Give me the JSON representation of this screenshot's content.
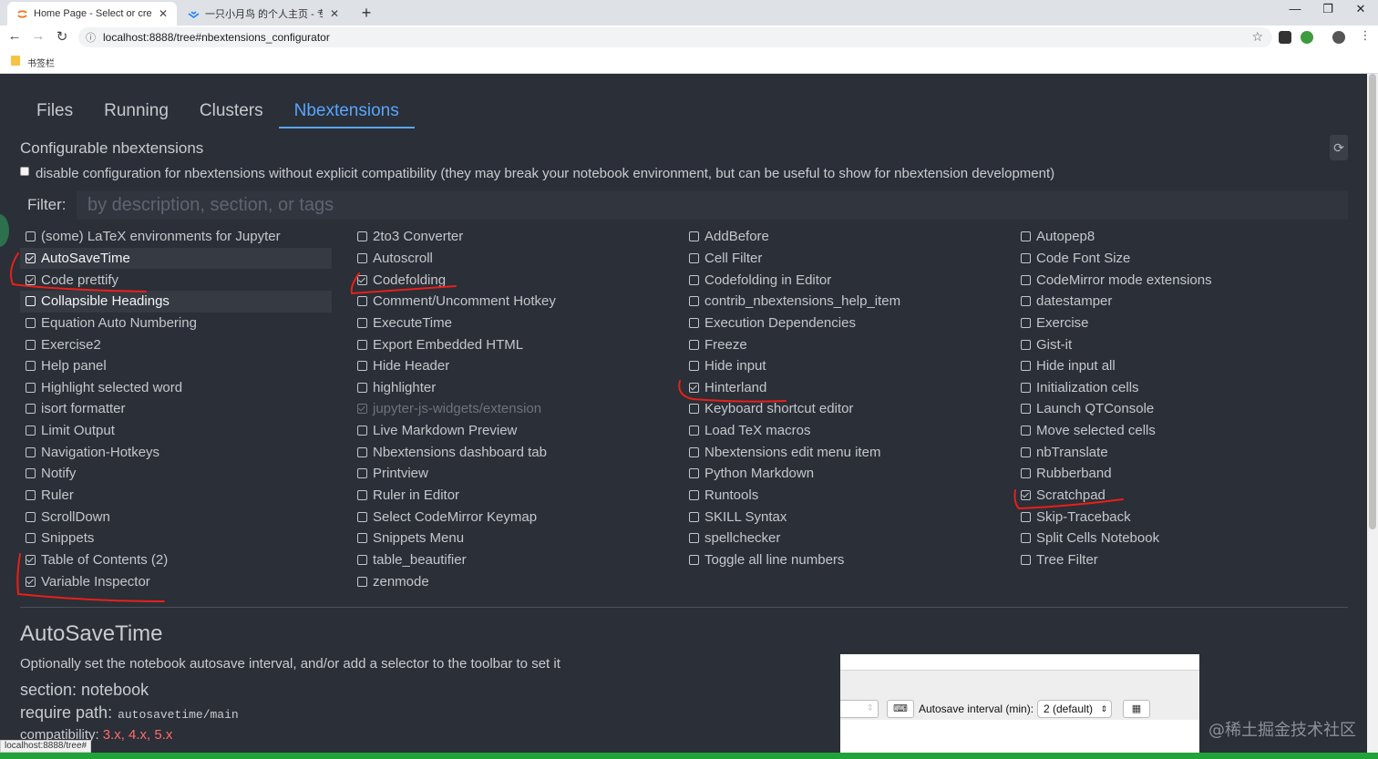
{
  "browser": {
    "tabs": [
      {
        "title": "Home Page - Select or create",
        "active": true
      },
      {
        "title": "一只小月鸟 的个人主页 - 专栏 -",
        "active": false
      }
    ],
    "url": "localhost:8888/tree#nbextensions_configurator",
    "bookmarks_label": "书签栏"
  },
  "nav": {
    "tabs": [
      "Files",
      "Running",
      "Clusters",
      "Nbextensions"
    ],
    "active": "Nbextensions"
  },
  "configurable_title": "Configurable nbextensions",
  "compat_checkbox_label": "disable configuration for nbextensions without explicit compatibility (they may break your notebook environment, but can be useful to show for nbextension development)",
  "filter": {
    "label": "Filter:",
    "placeholder": "by description, section, or tags"
  },
  "extensions": [
    {
      "label": "(some) LaTeX environments for Jupyter",
      "checked": false
    },
    {
      "label": "2to3 Converter",
      "checked": false
    },
    {
      "label": "AddBefore",
      "checked": false
    },
    {
      "label": "Autopep8",
      "checked": false
    },
    {
      "label": "AutoSaveTime",
      "checked": true,
      "selected": true
    },
    {
      "label": "Autoscroll",
      "checked": false
    },
    {
      "label": "Cell Filter",
      "checked": false
    },
    {
      "label": "Code Font Size",
      "checked": false
    },
    {
      "label": "Code prettify",
      "checked": true
    },
    {
      "label": "Codefolding",
      "checked": true
    },
    {
      "label": "Codefolding in Editor",
      "checked": false
    },
    {
      "label": "CodeMirror mode extensions",
      "checked": false
    },
    {
      "label": "Collapsible Headings",
      "checked": false,
      "selected": true
    },
    {
      "label": "Comment/Uncomment Hotkey",
      "checked": false
    },
    {
      "label": "contrib_nbextensions_help_item",
      "checked": false
    },
    {
      "label": "datestamper",
      "checked": false
    },
    {
      "label": "Equation Auto Numbering",
      "checked": false
    },
    {
      "label": "ExecuteTime",
      "checked": false
    },
    {
      "label": "Execution Dependencies",
      "checked": false
    },
    {
      "label": "Exercise",
      "checked": false
    },
    {
      "label": "Exercise2",
      "checked": false
    },
    {
      "label": "Export Embedded HTML",
      "checked": false
    },
    {
      "label": "Freeze",
      "checked": false
    },
    {
      "label": "Gist-it",
      "checked": false
    },
    {
      "label": "Help panel",
      "checked": false
    },
    {
      "label": "Hide Header",
      "checked": false
    },
    {
      "label": "Hide input",
      "checked": false
    },
    {
      "label": "Hide input all",
      "checked": false
    },
    {
      "label": "Highlight selected word",
      "checked": false
    },
    {
      "label": "highlighter",
      "checked": false
    },
    {
      "label": "Hinterland",
      "checked": true
    },
    {
      "label": "Initialization cells",
      "checked": false
    },
    {
      "label": "isort formatter",
      "checked": false
    },
    {
      "label": "jupyter-js-widgets/extension",
      "checked": true,
      "disabled": true
    },
    {
      "label": "Keyboard shortcut editor",
      "checked": false
    },
    {
      "label": "Launch QTConsole",
      "checked": false
    },
    {
      "label": "Limit Output",
      "checked": false
    },
    {
      "label": "Live Markdown Preview",
      "checked": false
    },
    {
      "label": "Load TeX macros",
      "checked": false
    },
    {
      "label": "Move selected cells",
      "checked": false
    },
    {
      "label": "Navigation-Hotkeys",
      "checked": false
    },
    {
      "label": "Nbextensions dashboard tab",
      "checked": false
    },
    {
      "label": "Nbextensions edit menu item",
      "checked": false
    },
    {
      "label": "nbTranslate",
      "checked": false
    },
    {
      "label": "Notify",
      "checked": false
    },
    {
      "label": "Printview",
      "checked": false
    },
    {
      "label": "Python Markdown",
      "checked": false
    },
    {
      "label": "Rubberband",
      "checked": false
    },
    {
      "label": "Ruler",
      "checked": false
    },
    {
      "label": "Ruler in Editor",
      "checked": false
    },
    {
      "label": "Runtools",
      "checked": false
    },
    {
      "label": "Scratchpad",
      "checked": true
    },
    {
      "label": "ScrollDown",
      "checked": false
    },
    {
      "label": "Select CodeMirror Keymap",
      "checked": false
    },
    {
      "label": "SKILL Syntax",
      "checked": false
    },
    {
      "label": "Skip-Traceback",
      "checked": false
    },
    {
      "label": "Snippets",
      "checked": false
    },
    {
      "label": "Snippets Menu",
      "checked": false
    },
    {
      "label": "spellchecker",
      "checked": false
    },
    {
      "label": "Split Cells Notebook",
      "checked": false
    },
    {
      "label": "Table of Contents (2)",
      "checked": true
    },
    {
      "label": "table_beautifier",
      "checked": false
    },
    {
      "label": "Toggle all line numbers",
      "checked": false
    },
    {
      "label": "Tree Filter",
      "checked": false
    },
    {
      "label": "Variable Inspector",
      "checked": true
    },
    {
      "label": "zenmode",
      "checked": false
    }
  ],
  "detail": {
    "title": "AutoSaveTime",
    "description": "Optionally set the notebook autosave interval, and/or add a selector to the toolbar to set it",
    "section_label": "section: notebook",
    "require_label": "require path:",
    "require_path": "autosavetime/main",
    "compat_label": "compatibility:",
    "compat_versions": "3.x, 4.x, 5.x"
  },
  "preview": {
    "autosave_label": "Autosave interval (min):",
    "autosave_value": "2 (default)"
  },
  "status_url": "localhost:8888/tree#",
  "watermark": "@稀土掘金技术社区",
  "colors": {
    "page_bg": "#2b2f37",
    "accent": "#58a6ff",
    "annotation_red": "#e8201a",
    "compat_red": "#ff6b6b"
  }
}
